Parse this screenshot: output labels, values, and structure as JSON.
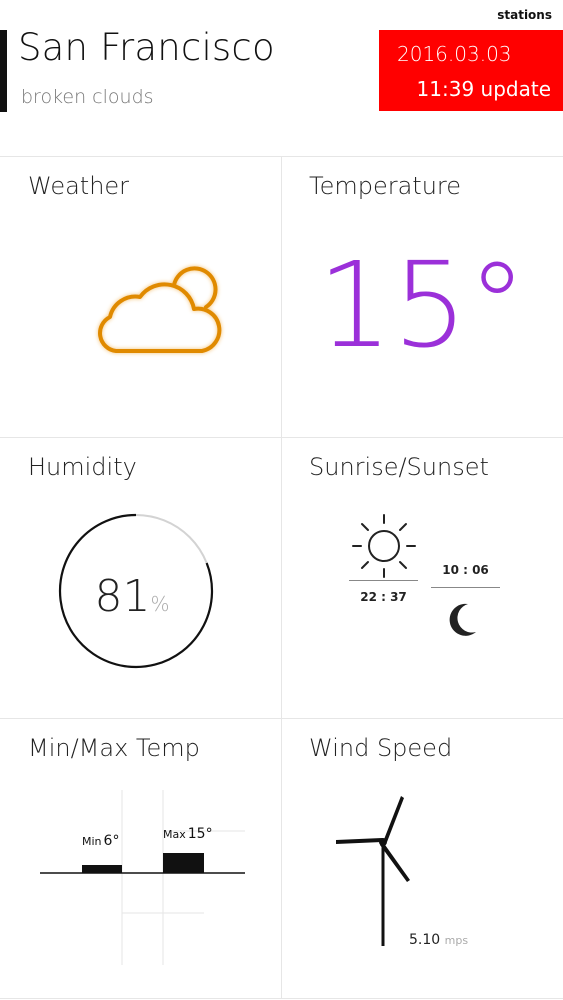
{
  "header": {
    "stations_link": "stations",
    "city": "San Francisco",
    "conditions": "broken clouds",
    "update_date": "2016.03.03",
    "update_time": "11:39 update"
  },
  "tiles": {
    "weather": {
      "title": "Weather",
      "icon": "broken-clouds-icon",
      "icon_color": "#e08a00"
    },
    "temperature": {
      "title": "Temperature",
      "value": "15°",
      "color": "#9b30d9"
    },
    "humidity": {
      "title": "Humidity",
      "value": "81",
      "unit": "%",
      "level_percent": 81
    },
    "sun": {
      "title": "Sunrise/Sunset",
      "sunrise_time": "22 : 37",
      "sunset_time": "10 : 06"
    },
    "minmax": {
      "title": "Min/Max Temp",
      "min_label": "Min",
      "min_value": "6°",
      "max_label": "Max",
      "max_value": "15°",
      "min": 6,
      "max": 15
    },
    "wind": {
      "title": "Wind Speed",
      "speed": "5.10",
      "unit": "mps"
    }
  },
  "colors": {
    "accent": "#ff0000",
    "temperature": "#9b30d9",
    "weather_icon": "#e08a00"
  }
}
